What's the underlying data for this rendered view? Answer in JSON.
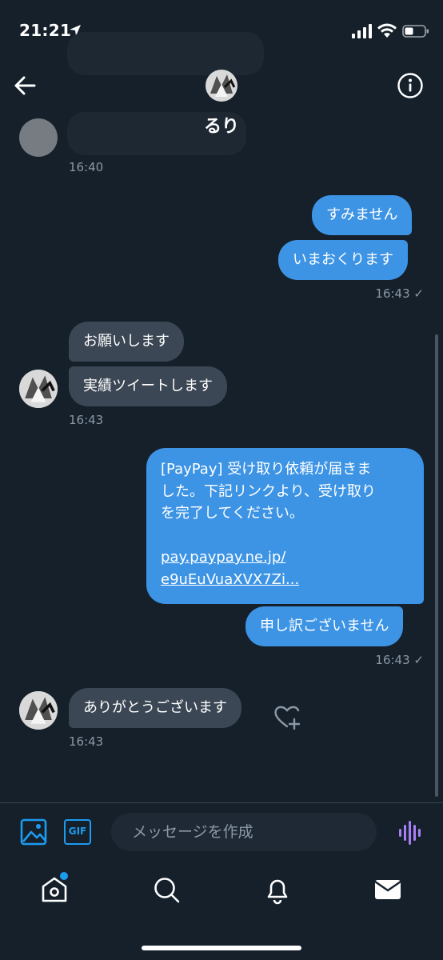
{
  "status_bar": {
    "time": "21:21"
  },
  "header": {
    "contact_name": "るり"
  },
  "messages": [
    {
      "id": "in-0-ts",
      "timestamp": "16:40"
    },
    {
      "id": "out-1",
      "text": "すみません"
    },
    {
      "id": "out-2",
      "text": "いまおくります",
      "timestamp": "16:43",
      "read_mark": "✓"
    },
    {
      "id": "in-1",
      "text": "お願いします"
    },
    {
      "id": "in-2",
      "text": "実績ツイートします",
      "timestamp": "16:43"
    },
    {
      "id": "out-3",
      "lines": [
        "[PayPay] 受け取り依頼が届きま",
        "した。下記リンクより、受け取り",
        "を完了してください。"
      ],
      "link_lines": [
        "pay.paypay.ne.jp/",
        "e9uEuVuaXVX7Zi..."
      ]
    },
    {
      "id": "out-4",
      "text": "申し訳ございません",
      "timestamp": "16:43",
      "read_mark": "✓"
    },
    {
      "id": "in-3",
      "text": "ありがとうございます",
      "timestamp": "16:43"
    }
  ],
  "composer": {
    "placeholder": "メッセージを作成",
    "gif_label": "GIF"
  },
  "colors": {
    "background": "#15202b",
    "outgoing": "#3d94e5",
    "incoming": "#3b4754",
    "accent": "#1d9bf0",
    "voice": "#a87ff5"
  },
  "icons": {
    "back": "arrow-left-icon",
    "info": "info-icon",
    "image": "image-icon",
    "gif": "gif-icon",
    "voice": "voice-wave-icon",
    "heart": "heart-plus-icon",
    "home": "home-icon",
    "search": "search-icon",
    "notifications": "bell-icon",
    "messages": "mail-icon"
  }
}
